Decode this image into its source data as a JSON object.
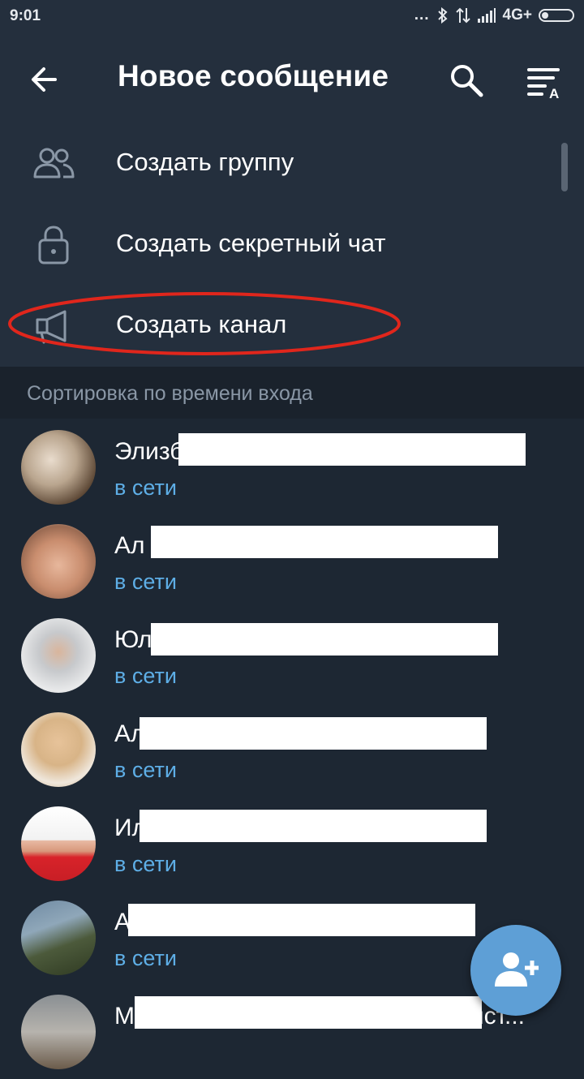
{
  "status_bar": {
    "time": "9:01",
    "dots": "...",
    "network": "4G+",
    "icons": [
      "bluetooth-icon",
      "data-transfer-icon",
      "signal-icon",
      "battery-icon"
    ]
  },
  "app_bar": {
    "title": "Новое сообщение",
    "icons": [
      "back-arrow-icon",
      "search-icon",
      "sort-alpha-icon"
    ]
  },
  "menu": {
    "items": [
      {
        "label": "Создать группу",
        "icon": "group-icon"
      },
      {
        "label": "Создать секретный чат",
        "icon": "lock-icon"
      },
      {
        "label": "Создать канал",
        "icon": "megaphone-icon"
      }
    ]
  },
  "section": {
    "header": "Сортировка по времени входа"
  },
  "contacts": [
    {
      "name": "Элизб",
      "status": "в сети"
    },
    {
      "name": "Ал",
      "status": "в сети"
    },
    {
      "name": "Юл",
      "status": "в сети"
    },
    {
      "name": "Ал",
      "status": "в сети"
    },
    {
      "name": "Ил",
      "status": "в сети"
    },
    {
      "name": "А",
      "status": "в сети"
    },
    {
      "name": "М",
      "status": ""
    }
  ],
  "last_contact_tail": "нст...",
  "fab": {
    "icon": "add-contact-icon"
  },
  "colors": {
    "background": "#1d2733",
    "app_bar": "#242f3d",
    "section_header_bg": "#1a222c",
    "online_status": "#5eaee6",
    "fab": "#5e9fd6",
    "highlight_ellipse": "#e0261c"
  }
}
